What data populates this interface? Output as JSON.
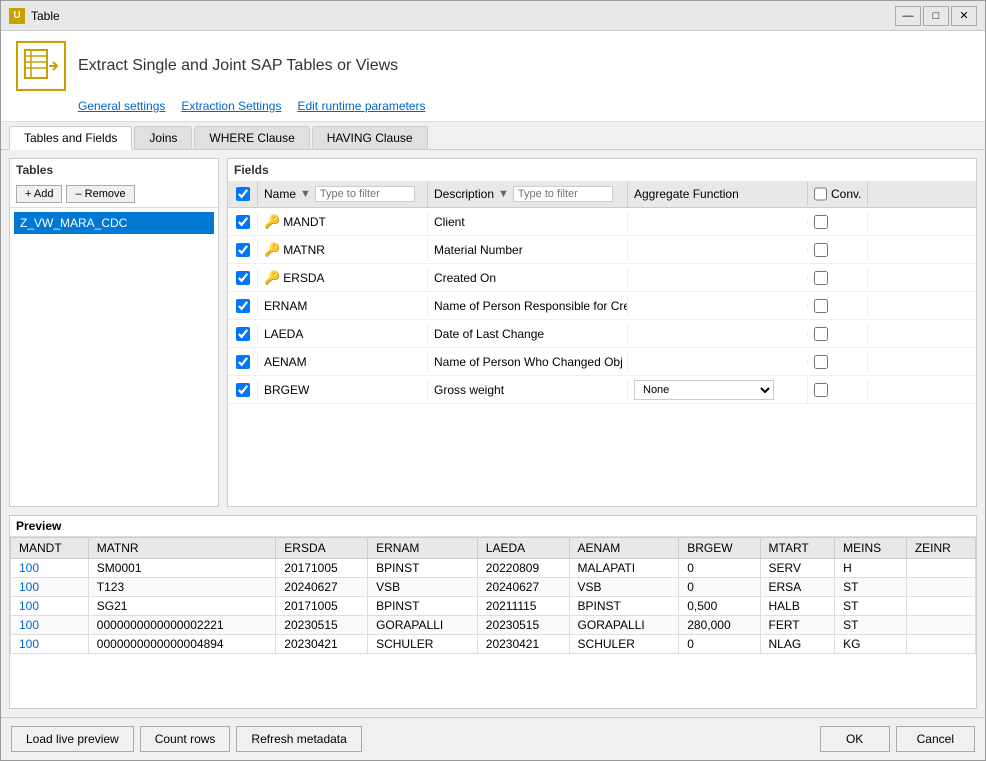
{
  "window": {
    "title": "Table",
    "icon": "U"
  },
  "header": {
    "title": "Extract Single and Joint SAP Tables or Views",
    "links": [
      "General settings",
      "Extraction Settings",
      "Edit runtime parameters"
    ]
  },
  "tabs": [
    "Tables and Fields",
    "Joins",
    "WHERE Clause",
    "HAVING Clause"
  ],
  "active_tab": "Tables and Fields",
  "tables_panel": {
    "title": "Tables",
    "add_label": "+ Add",
    "remove_label": "– Remove",
    "items": [
      "Z_VW_MARA_CDC"
    ]
  },
  "fields_panel": {
    "title": "Fields",
    "columns": [
      "Name",
      "Description",
      "Aggregate Function",
      "Conv."
    ],
    "name_filter_placeholder": "Type to filter",
    "desc_filter_placeholder": "Type to filter",
    "rows": [
      {
        "checked": true,
        "key": true,
        "name": "MANDT",
        "description": "Client",
        "agg": "",
        "conv": false
      },
      {
        "checked": true,
        "key": true,
        "name": "MATNR",
        "description": "Material Number",
        "agg": "",
        "conv": false
      },
      {
        "checked": true,
        "key": true,
        "name": "ERSDA",
        "description": "Created On",
        "agg": "",
        "conv": false
      },
      {
        "checked": true,
        "key": false,
        "name": "ERNAM",
        "description": "Name of Person Responsible for Cre",
        "agg": "",
        "conv": false
      },
      {
        "checked": true,
        "key": false,
        "name": "LAEDA",
        "description": "Date of Last Change",
        "agg": "",
        "conv": false
      },
      {
        "checked": true,
        "key": false,
        "name": "AENAM",
        "description": "Name of Person Who Changed Obj",
        "agg": "",
        "conv": false
      },
      {
        "checked": true,
        "key": false,
        "name": "BRGEW",
        "description": "Gross weight",
        "agg": "None",
        "conv": false
      }
    ]
  },
  "preview": {
    "title": "Preview",
    "columns": [
      "MANDT",
      "MATNR",
      "ERSDA",
      "ERNAM",
      "LAEDA",
      "AENAM",
      "BRGEW",
      "MTART",
      "MEINS",
      "ZEINR"
    ],
    "rows": [
      [
        "100",
        "SM0001",
        "20171005",
        "BPINST",
        "20220809",
        "MALAPATI",
        "0",
        "SERV",
        "H",
        ""
      ],
      [
        "100",
        "T123",
        "20240627",
        "VSB",
        "20240627",
        "VSB",
        "0",
        "ERSA",
        "ST",
        ""
      ],
      [
        "100",
        "SG21",
        "20171005",
        "BPINST",
        "20211115",
        "BPINST",
        "0,500",
        "HALB",
        "ST",
        ""
      ],
      [
        "100",
        "0000000000000002221",
        "20230515",
        "GORAPALLI",
        "20230515",
        "GORAPALLI",
        "280,000",
        "FERT",
        "ST",
        ""
      ],
      [
        "100",
        "0000000000000004894",
        "20230421",
        "SCHULER",
        "20230421",
        "SCHULER",
        "0",
        "NLAG",
        "KG",
        ""
      ]
    ]
  },
  "bottom_buttons": {
    "load_preview": "Load live preview",
    "count_rows": "Count rows",
    "refresh_metadata": "Refresh metadata",
    "ok": "OK",
    "cancel": "Cancel"
  }
}
